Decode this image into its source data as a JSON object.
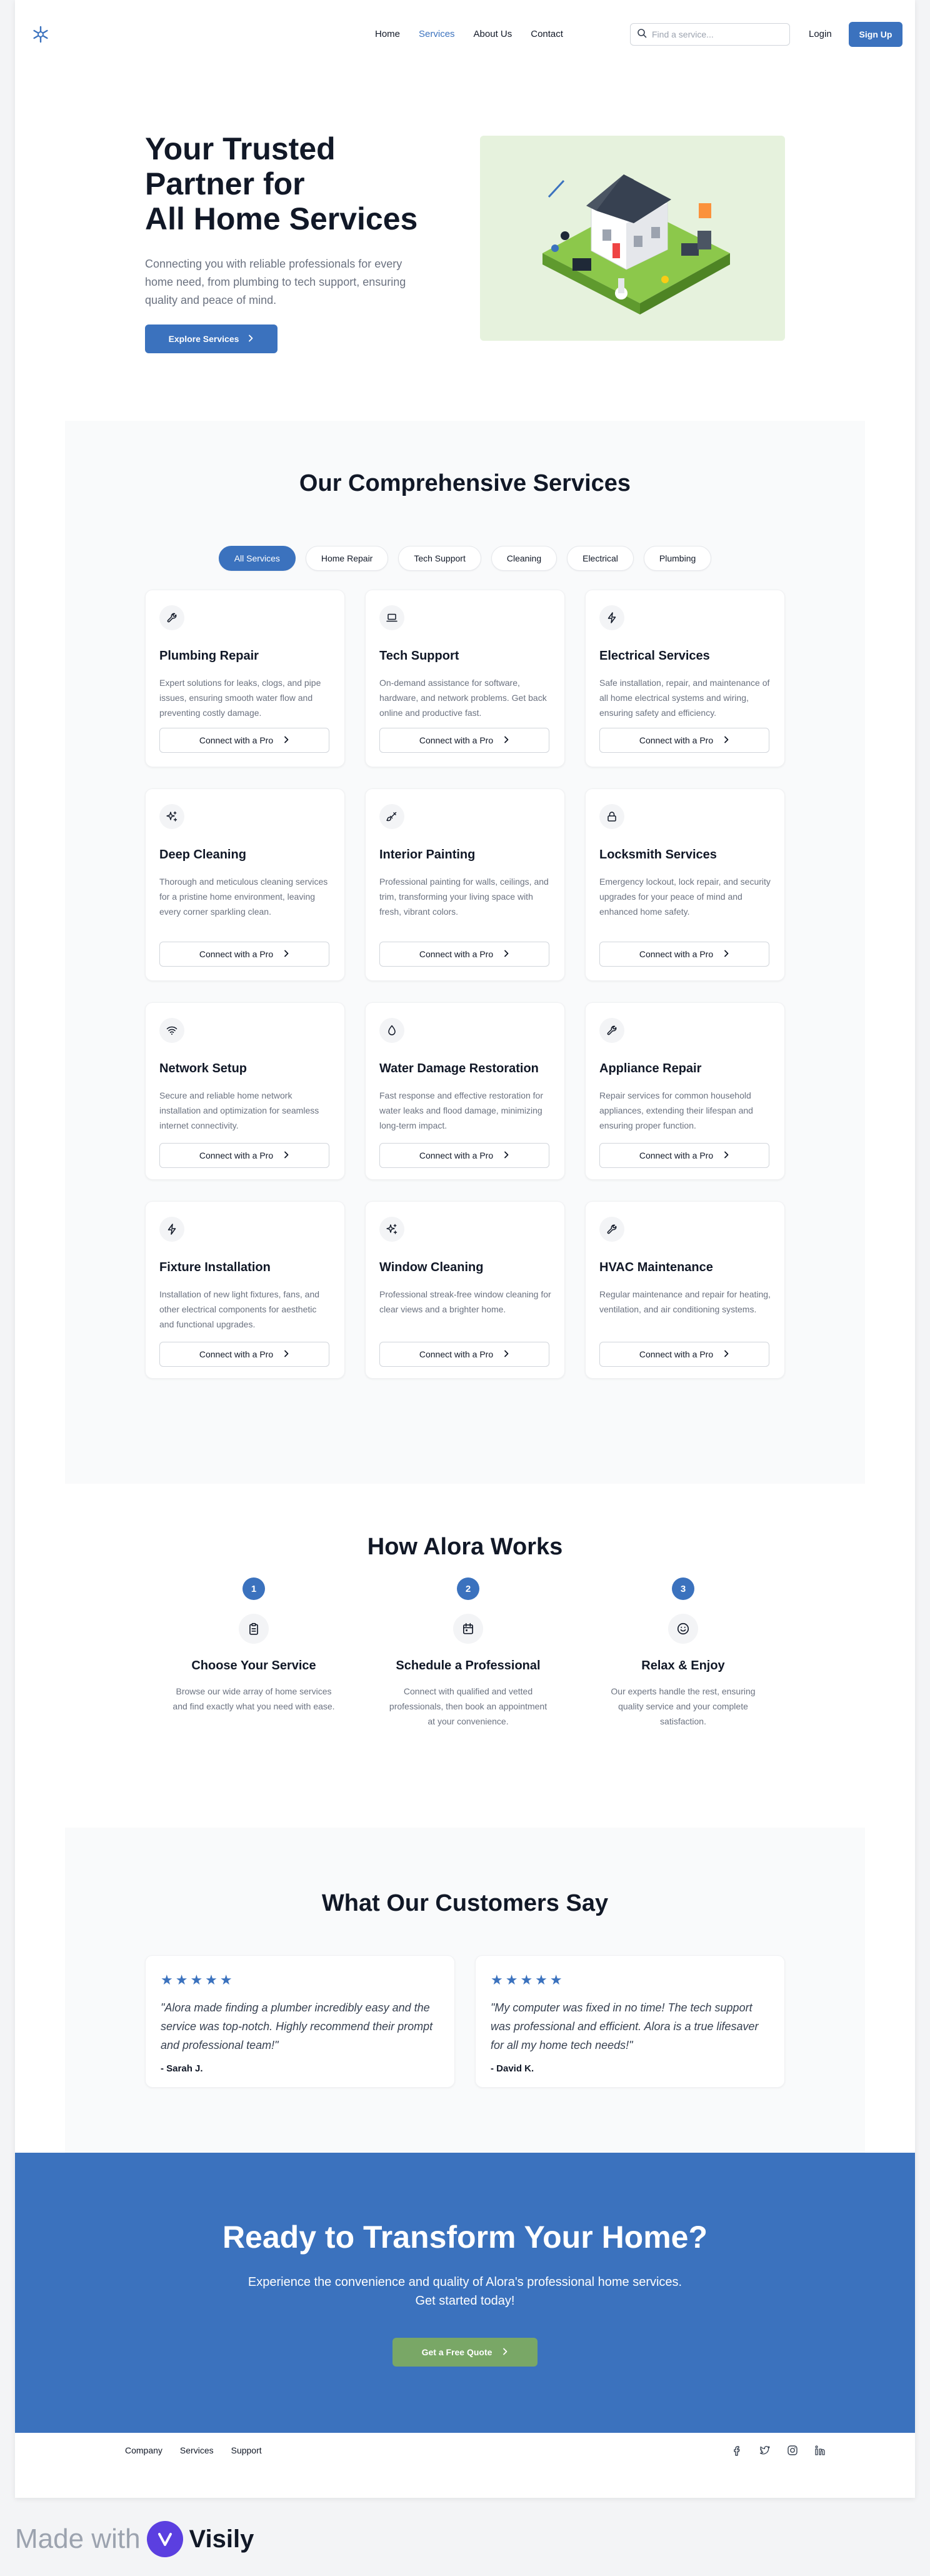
{
  "nav": {
    "links": [
      {
        "label": "Home"
      },
      {
        "label": "Services"
      },
      {
        "label": "About Us"
      },
      {
        "label": "Contact"
      }
    ],
    "search_placeholder": "Find a service...",
    "login": "Login",
    "signup": "Sign Up"
  },
  "hero": {
    "title_line1": "Your Trusted",
    "title_line2": "Partner for",
    "title_line3": "All Home Services",
    "text": "Connecting you with reliable professionals for every home need, from plumbing to tech support, ensuring quality and peace of mind.",
    "button": "Explore Services"
  },
  "services": {
    "title": "Our Comprehensive Services",
    "filters": [
      "All Services",
      "Home Repair",
      "Tech Support",
      "Cleaning",
      "Electrical",
      "Plumbing"
    ],
    "active_filter": "All Services",
    "cards": [
      {
        "icon": "wrench-icon",
        "title": "Plumbing Repair",
        "text": "Expert solutions for leaks, clogs, and pipe issues, ensuring smooth water flow and preventing costly damage.",
        "button": "Connect with a Pro"
      },
      {
        "icon": "laptop-icon",
        "title": "Tech Support",
        "text": "On-demand assistance for software, hardware, and network problems. Get back online and productive fast.",
        "button": "Connect with a Pro"
      },
      {
        "icon": "bolt-icon",
        "title": "Electrical Services",
        "text": "Safe installation, repair, and maintenance of all home electrical systems and wiring, ensuring safety and efficiency.",
        "button": "Connect with a Pro"
      },
      {
        "icon": "sparkles-icon",
        "title": "Deep Cleaning",
        "text": "Thorough and meticulous cleaning services for a pristine home environment, leaving every corner sparkling clean.",
        "button": "Connect with a Pro"
      },
      {
        "icon": "paintbrush-icon",
        "title": "Interior Painting",
        "text": "Professional painting for walls, ceilings, and trim, transforming your living space with fresh, vibrant colors.",
        "button": "Connect with a Pro"
      },
      {
        "icon": "lock-icon",
        "title": "Locksmith Services",
        "text": "Emergency lockout, lock repair, and security upgrades for your peace of mind and enhanced home safety.",
        "button": "Connect with a Pro"
      },
      {
        "icon": "wifi-icon",
        "title": "Network Setup",
        "text": "Secure and reliable home network installation and optimization for seamless internet connectivity.",
        "button": "Connect with a Pro"
      },
      {
        "icon": "droplet-icon",
        "title": "Water Damage Restoration",
        "text": "Fast response and effective restoration for water leaks and flood damage, minimizing long-term impact.",
        "button": "Connect with a Pro"
      },
      {
        "icon": "wrench-icon",
        "title": "Appliance Repair",
        "text": "Repair services for common household appliances, extending their lifespan and ensuring proper function.",
        "button": "Connect with a Pro"
      },
      {
        "icon": "bolt-icon",
        "title": "Fixture Installation",
        "text": "Installation of new light fixtures, fans, and other electrical components for aesthetic and functional upgrades.",
        "button": "Connect with a Pro"
      },
      {
        "icon": "sparkles-icon",
        "title": "Window Cleaning",
        "text": "Professional streak-free window cleaning for clear views and a brighter home.",
        "button": "Connect with a Pro"
      },
      {
        "icon": "wrench-icon",
        "title": "HVAC Maintenance",
        "text": "Regular maintenance and repair for heating, ventilation, and air conditioning systems.",
        "button": "Connect with a Pro"
      }
    ]
  },
  "how": {
    "title": "How Alora Works",
    "steps": [
      {
        "num": "1",
        "icon": "clipboard-icon",
        "title": "Choose Your Service",
        "text": "Browse our wide array of home services and find exactly what you need with ease."
      },
      {
        "num": "2",
        "icon": "calendar-icon",
        "title": "Schedule a Professional",
        "text": "Connect with qualified and vetted professionals, then book an appointment at your convenience."
      },
      {
        "num": "3",
        "icon": "smile-icon",
        "title": "Relax & Enjoy",
        "text": "Our experts handle the rest, ensuring quality service and your complete satisfaction."
      }
    ]
  },
  "testimonials": {
    "title": "What Our Customers Say",
    "items": [
      {
        "stars": "★★★★★",
        "quote": "\"Alora made finding a plumber incredibly easy and the service was top-notch. Highly recommend their prompt and professional team!\"",
        "author": "- Sarah J."
      },
      {
        "stars": "★★★★★",
        "quote": "\"My computer was fixed in no time! The tech support was professional and efficient. Alora is a true lifesaver for all my home tech needs!\"",
        "author": "- David K."
      }
    ]
  },
  "cta": {
    "title": "Ready to Transform Your Home?",
    "text": "Experience the convenience and quality of Alora's professional home services. Get started today!",
    "button": "Get a Free Quote"
  },
  "footer": {
    "links": [
      "Company",
      "Services",
      "Support"
    ],
    "social": [
      "facebook-icon",
      "twitter-icon",
      "instagram-icon",
      "linkedin-icon"
    ]
  },
  "badge": {
    "made_with": "Made with",
    "brand": "Visily"
  },
  "colors": {
    "primary": "#3b72be",
    "cta_button": "#79a766",
    "hero_image_bg": "#e6f2dd"
  }
}
